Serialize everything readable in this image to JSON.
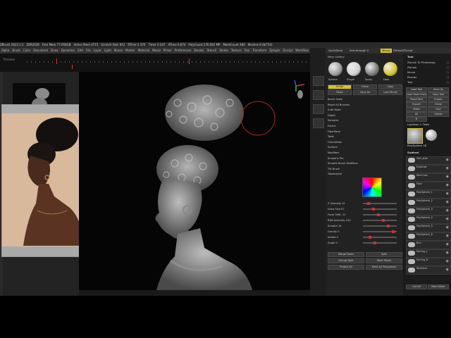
{
  "app": {
    "title_items": [
      "ZBrush 2023.1.2",
      "ZBR2028",
      "Free Mem 77.956GB",
      "Active Mem 4715",
      "Scratch Disk 912",
      "RTime 2.376",
      "Timer 0.247",
      "ATime 6.874",
      "PolyCount 276.062 MP",
      "MeshCount 480",
      "Meshes 8 (8/720)"
    ]
  },
  "menubar": [
    "Alpha",
    "Brush",
    "Color",
    "Document",
    "Draw",
    "Dynamics",
    "Edit",
    "File",
    "Layer",
    "Light",
    "Macro",
    "Marker",
    "Material",
    "Movie",
    "Picker",
    "Preferences",
    "Render",
    "Stencil",
    "Stroke",
    "Texture",
    "Tool",
    "Transform",
    "Zplugin",
    "Zscript",
    "Workflow",
    "Help"
  ],
  "timeline": {
    "label": "Timeline"
  },
  "right_header": {
    "quicksave": "QuickSave",
    "see_through": "See-through 0",
    "menus": "Menus",
    "default_script": "DefaultZScript"
  },
  "brush": {
    "title": "Move Gallery",
    "rows": [
      "Brush Scale",
      "Reset All Brushes",
      "Auto Mask",
      "Depth",
      "Samples",
      "Elastic",
      "FiberMesh",
      "Twist",
      "Orientation",
      "Surface",
      "Modifiers",
      "Sculptris Pro",
      "Smooth Brush Modifiers",
      "Tilt Brush",
      "Topological"
    ],
    "sphere_labels": [
      "Sphere",
      "Single",
      "Spray",
      "Dots"
    ],
    "buttons": {
      "sculpt": "Sculpt",
      "clone": "Clone",
      "copy": "Copy",
      "paste": "Paste",
      "save": "Save As",
      "load": "Load Brush"
    },
    "slider_labels": [
      "Z Intensity 41",
      "Draw Size 87",
      "Focal Shift -11",
      "RGB Intensity 100",
      "Smooth 14",
      "Gravity 0",
      "Imbed 0",
      "Angle 0"
    ],
    "bottom_row": [
      "Merge Down",
      "Split",
      "Groups Split",
      "Weld Points",
      "Project All",
      "Mask by Polygroups"
    ]
  },
  "tools": {
    "title": "Tool",
    "menu_items": [
      "Zbrush To Photoshop",
      "Zbrush",
      "Movie",
      "Render",
      "Tool"
    ],
    "top_buttons": [
      "Load Tool",
      "Save As",
      "Load Tools From Project",
      "Copy Tool",
      "Paste Tool",
      "Import",
      "Export",
      "Clone",
      "Make PolyMesh3D",
      "GoZ",
      "All",
      "Visible",
      "R"
    ],
    "lightbox": "Lightbox > Tools",
    "current_tool": "PolySphere 48",
    "subtool_header": "Subtool",
    "subtools": [
      "Hair_side",
      "Eyebrow",
      "SkinCurls",
      "Face",
      "PolySphere_1",
      "PolySphere_2",
      "PolySphere_3",
      "PolySphere_4",
      "PolySphere_5",
      "PolySphere_6",
      "Bun",
      "Earring_L",
      "Earring_R",
      "Necklace"
    ],
    "bottom": [
      "List All",
      "New Folder"
    ]
  },
  "colors": {
    "accent": "#d6c22b",
    "slider_knob": "#d03030",
    "timeline_marker": "#e03030"
  },
  "icons": [
    "ui-gizmo-icon",
    "share-icon",
    "eye-icon"
  ]
}
